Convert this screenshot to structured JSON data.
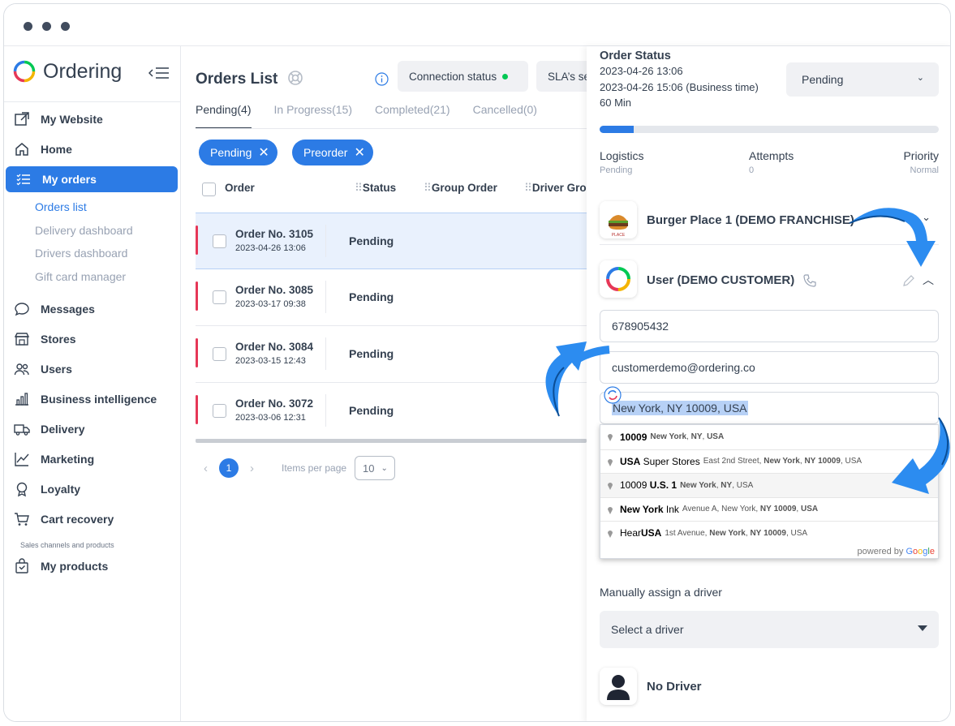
{
  "app": {
    "brand": "Ordering"
  },
  "sidebar": {
    "items": [
      {
        "label": "My Website",
        "icon": "external-link-icon"
      },
      {
        "label": "Home",
        "icon": "home-icon"
      },
      {
        "label": "My orders",
        "icon": "list-icon"
      },
      {
        "label": "Messages",
        "icon": "chat-icon"
      },
      {
        "label": "Stores",
        "icon": "store-icon"
      },
      {
        "label": "Users",
        "icon": "users-icon"
      },
      {
        "label": "Business intelligence",
        "icon": "bar-chart-icon"
      },
      {
        "label": "Delivery",
        "icon": "truck-icon"
      },
      {
        "label": "Marketing",
        "icon": "trend-line-icon"
      },
      {
        "label": "Loyalty",
        "icon": "medal-icon"
      },
      {
        "label": "Cart recovery",
        "icon": "cart-icon"
      },
      {
        "label": "My products",
        "icon": "bag-icon"
      }
    ],
    "sub_items": [
      "Orders list",
      "Delivery dashboard",
      "Drivers dashboard",
      "Gift card manager"
    ],
    "section_label": "Sales channels and products"
  },
  "main": {
    "title": "Orders List",
    "connection_status": "Connection status",
    "sla_button": "SLA’s se",
    "tabs": [
      "Pending(4)",
      "In Progress(15)",
      "Completed(21)",
      "Cancelled(0)"
    ],
    "chips": [
      "Pending",
      "Preorder"
    ],
    "columns": [
      "Order",
      "Status",
      "Group Order",
      "Driver Gro"
    ],
    "rows": [
      {
        "order": "Order No. 3105",
        "date": "2023-04-26 13:06",
        "status": "Pending"
      },
      {
        "order": "Order No. 3085",
        "date": "2023-03-17 09:38",
        "status": "Pending"
      },
      {
        "order": "Order No. 3084",
        "date": "2023-03-15 12:43",
        "status": "Pending"
      },
      {
        "order": "Order No. 3072",
        "date": "2023-03-06 12:31",
        "status": "Pending"
      }
    ],
    "pager": {
      "current_page": "1",
      "items_per_page_label": "Items per page",
      "items_per_page": "10"
    }
  },
  "panel": {
    "order_status_title": "Order Status",
    "date_line": "2023-04-26 13:06",
    "business_time_line": "2023-04-26 15:06 (Business time)",
    "duration": "60 Min",
    "status_value": "Pending",
    "progress_fraction": 0.1,
    "meta": [
      {
        "label": "Logistics",
        "value": "Pending"
      },
      {
        "label": "Attempts",
        "value": "0"
      },
      {
        "label": "Priority",
        "value": "Normal"
      }
    ],
    "business_name": "Burger Place 1 (DEMO FRANCHISE)",
    "business_logo_text": "Burger PLACE",
    "customer_name": "User (DEMO CUSTOMER)",
    "phone": "678905432",
    "email": "customerdemo@ordering.co",
    "address": "New York, NY 10009, USA",
    "autocomplete": [
      {
        "main_html": "<b>10009</b>",
        "secondary_html": "<b>New York</b>, <b>NY</b>, <b>USA</b>"
      },
      {
        "main_html": "<b>USA</b> Super Stores",
        "secondary_html": "East 2nd Street, <b>New York</b>, <b>NY</b> <b>10009</b>, USA"
      },
      {
        "main_html": "10009 <b>U.S. 1</b>",
        "secondary_html": "<b>New York</b>, <b>NY</b>, USA"
      },
      {
        "main_html": "<b>New York</b> Ink",
        "secondary_html": "Avenue A, New York, <b>NY</b> <b>10009</b>, <b>USA</b>"
      },
      {
        "main_html": "Hear<b>USA</b>",
        "secondary_html": "1st Avenue, <b>New York</b>, <b>NY</b> <b>10009</b>, USA"
      }
    ],
    "powered_by": "powered by",
    "google": "Google",
    "assign_label": "Manually assign a driver",
    "driver_placeholder": "Select a driver",
    "no_driver": "No Driver"
  },
  "colors": {
    "accent": "#2c7be5",
    "text": "#344050",
    "muted": "#98a2b3",
    "danger": "#e63757",
    "online": "#00c853"
  }
}
